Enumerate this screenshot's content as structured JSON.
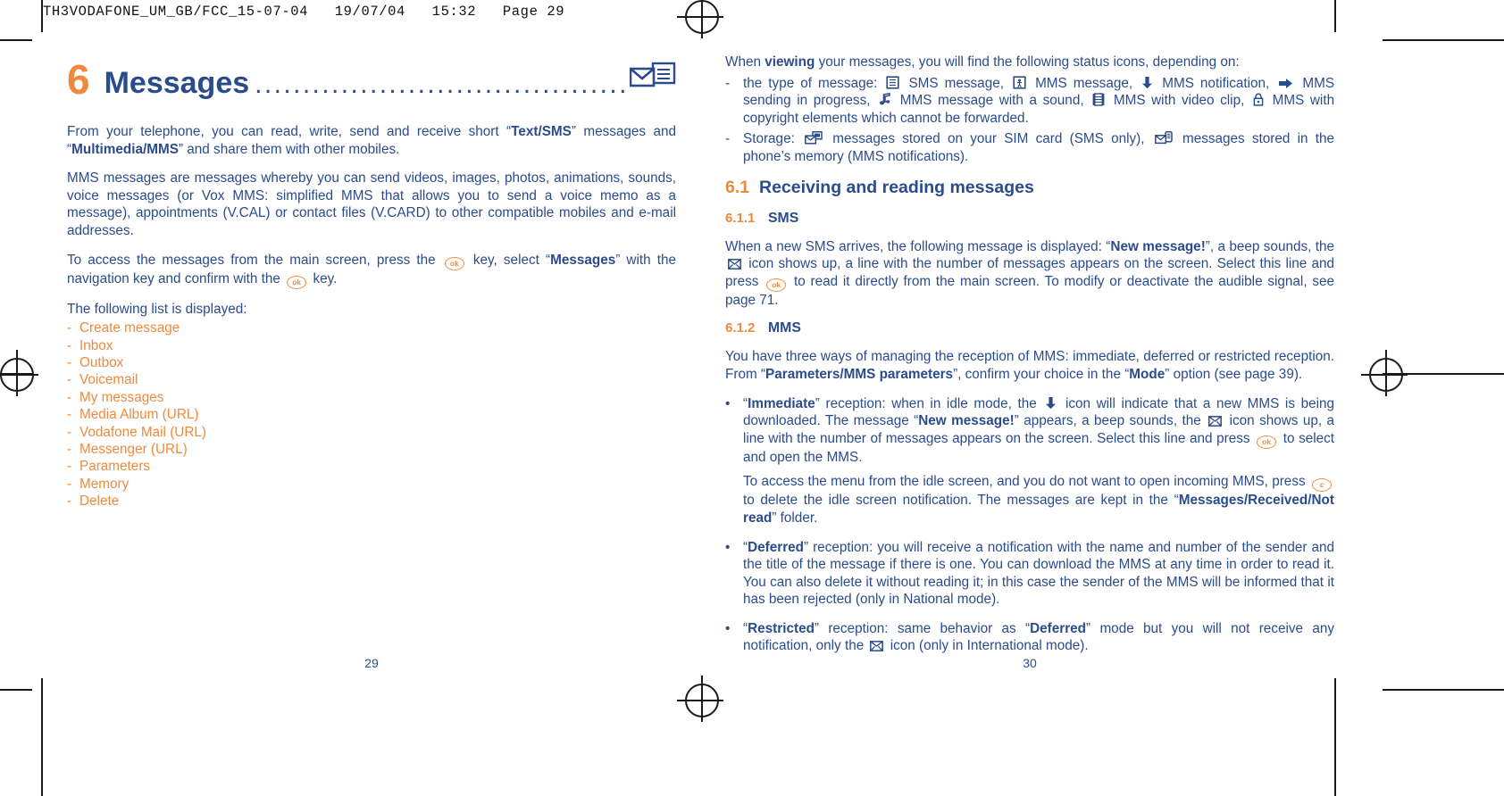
{
  "slug": "TH3VODAFONE_UM_GB/FCC_15-07-04   19/07/04   15:32   Page 29",
  "colors": {
    "blue": "#2b4c8c",
    "orange": "#ef8a3c",
    "black": "#1a1a1a"
  },
  "left_page": {
    "chapter_number": "6",
    "chapter_title": "Messages",
    "chapter_dots": "................................................................",
    "chapter_icon": "envelope-document-icon",
    "paragraphs": {
      "intro1_a": "From your telephone, you can read, write, send and receive short “",
      "intro1_b": "Text/SMS",
      "intro1_c": "” messages and “",
      "intro1_d": "Multimedia/MMS",
      "intro1_e": "” and share them with other mobiles.",
      "intro2": "MMS messages are messages whereby you can send videos, images, photos, animations, sounds, voice messages (or Vox MMS: simplified MMS that allows you to send a voice memo as a message), appointments (V.CAL) or contact files (V.CARD) to other compatible mobiles and e-mail addresses.",
      "access_a": "To access the messages from the main screen, press the",
      "access_b": "key, select “",
      "access_c": "Messages",
      "access_d": "” with the navigation key and confirm with the",
      "access_e": "key.",
      "list_lead": "The following list is displayed:"
    },
    "menu_items": [
      "Create message",
      "Inbox",
      "Outbox",
      "Voicemail",
      "My messages",
      "Media Album (URL)",
      "Vodafone Mail (URL)",
      "Messenger (URL)",
      "Parameters",
      "Memory",
      "Delete"
    ],
    "folio": "29"
  },
  "right_page": {
    "viewing": {
      "lead_a": "When ",
      "lead_b": "viewing",
      "lead_c": " your messages, you will find the following status icons, depending on:",
      "type_marker": "-",
      "type_1": "the type of message:",
      "type_2": "SMS message,",
      "type_3": "MMS message,",
      "type_4": "MMS notification,",
      "type_5": "MMS sending in progress,",
      "type_6": "MMS message with a sound,",
      "type_7": "MMS with video clip,",
      "type_8": "MMS with copyright elements which cannot be forwarded.",
      "storage_marker": "-",
      "storage_1": "Storage:",
      "storage_2": "messages stored on your SIM card (SMS only),",
      "storage_3": "messages stored in the phone’s memory (MMS notifications)."
    },
    "icons": {
      "sms": "sms-message-icon",
      "mms": "mms-message-icon",
      "mms_notification": "down-arrow-icon",
      "mms_sending": "right-arrow-icon",
      "mms_sound": "music-note-icon",
      "mms_video": "film-strip-icon",
      "mms_copyright": "padlock-icon",
      "sim_storage": "envelope-sim-card-icon",
      "phone_storage": "envelope-phone-icon",
      "envelope": "envelope-icon",
      "key_ok": "ok-key-icon",
      "key_c": "c-key-icon"
    },
    "section_6_1": {
      "num": "6.1",
      "title": "Receiving and reading messages"
    },
    "section_6_1_1": {
      "num": "6.1.1",
      "title": "SMS",
      "body_a": "When a new SMS arrives, the following message is displayed: “",
      "body_b": "New message!",
      "body_c": "”, a beep sounds, the",
      "body_d": "icon shows up, a line with the number of messages appears on the screen. Select this line and press",
      "body_e": "to read it directly from the main screen. To modify or deactivate the audible signal, see page 71."
    },
    "section_6_1_2": {
      "num": "6.1.2",
      "title": "MMS",
      "intro_a": "You have three ways of managing the reception of MMS: immediate, deferred or restricted reception. From “",
      "intro_b": "Parameters/MMS parameters",
      "intro_c": "”, confirm your choice in the “",
      "intro_d": "Mode",
      "intro_e": "” option (see page 39).",
      "bullets": [
        {
          "marker": "•",
          "b1": "Immediate",
          "t1": "” reception: when in idle mode, the",
          "t2": "icon will indicate that a new MMS is being downloaded. The message “",
          "b2": "New message!",
          "t3": "” appears, a beep sounds, the",
          "t4": "icon shows up, a line with the number of messages appears on the screen. Select this line and press",
          "t5": "to select and open the MMS."
        }
      ],
      "sub_para": {
        "a": "To access the menu from the idle screen, and you do not want to open incoming MMS, press",
        "b": "to delete the idle screen notification. The messages are kept in the “",
        "c": "Messages/Received/Not read",
        "d": "” folder."
      },
      "bullet_deferred": {
        "marker": "•",
        "lead": "Deferred",
        "text": "” reception: you will receive a notification with the name and number of the sender and the title of the message if there is one. You can download the MMS at any time in order to read it. You can also delete it without reading it; in this case the sender of the MMS will be informed that it has been rejected (only in National mode)."
      },
      "bullet_restricted": {
        "marker": "•",
        "lead": "Restricted",
        "t1": "” reception: same behavior as “",
        "b2": "Deferred",
        "t2": "” mode but you will not receive any notification, only the",
        "t3": "icon (only in International mode)."
      }
    },
    "folio": "30"
  }
}
